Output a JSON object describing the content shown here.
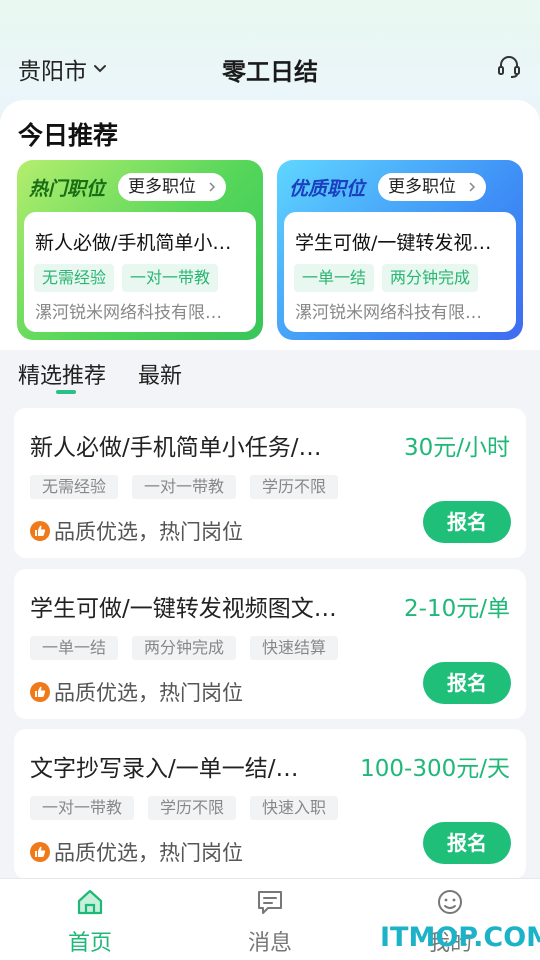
{
  "header": {
    "city": "贵阳市",
    "title": "零工日结"
  },
  "today": {
    "title": "今日推荐",
    "promos": [
      {
        "label": "热门职位",
        "more": "更多职位",
        "job": "新人必做/手机简单小…",
        "tags": [
          "无需经验",
          "一对一带教"
        ],
        "company": "漯河锐米网络科技有限…"
      },
      {
        "label": "优质职位",
        "more": "更多职位",
        "job": "学生可做/一键转发视…",
        "tags": [
          "一单一结",
          "两分钟完成"
        ],
        "company": "漯河锐米网络科技有限…"
      }
    ]
  },
  "tabs": [
    "精选推荐",
    "最新"
  ],
  "jobs": [
    {
      "title": "新人必做/手机简单小任务/…",
      "price": "30元/小时",
      "tags": [
        "无需经验",
        "一对一带教",
        "学历不限"
      ],
      "hot": "品质优选，热门岗位",
      "apply": "报名"
    },
    {
      "title": "学生可做/一键转发视频图文…",
      "price": "2-10元/单",
      "tags": [
        "一单一结",
        "两分钟完成",
        "快速结算"
      ],
      "hot": "品质优选，热门岗位",
      "apply": "报名"
    },
    {
      "title": "文字抄写录入/一单一结/…",
      "price": "100-300元/天",
      "tags": [
        "一对一带教",
        "学历不限",
        "快速入职"
      ],
      "hot": "品质优选，热门岗位",
      "apply": "报名"
    }
  ],
  "nav": [
    {
      "label": "首页",
      "icon": "home-icon",
      "active": true
    },
    {
      "label": "消息",
      "icon": "message-icon",
      "active": false
    },
    {
      "label": "我的",
      "icon": "profile-icon",
      "active": false
    }
  ],
  "watermark": "ITMOP.COM",
  "colors": {
    "accent": "#1fbf7a",
    "price": "#1fb878"
  }
}
